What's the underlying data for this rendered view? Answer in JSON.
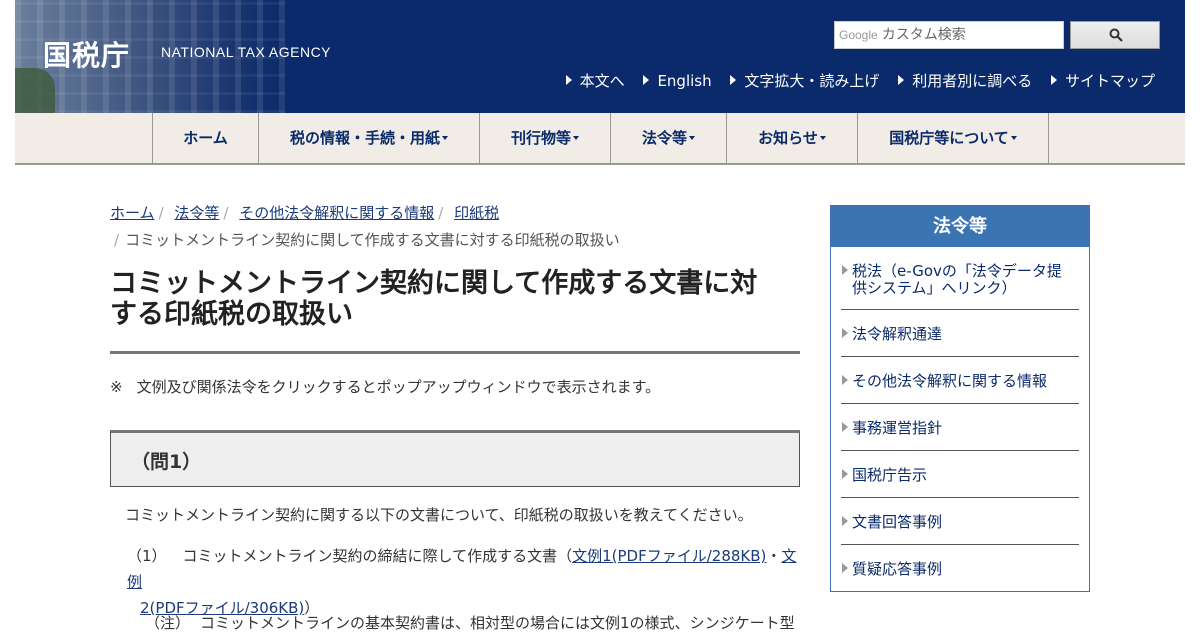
{
  "header": {
    "logo_jp": "国税庁",
    "logo_en": "NATIONAL TAX AGENCY",
    "search_brand": "Google",
    "search_placeholder": "カスタム検索",
    "util_links": [
      "本文へ",
      "English",
      "文字拡大・読み上げ",
      "利用者別に調べる",
      "サイトマップ"
    ]
  },
  "nav": {
    "items": [
      {
        "label": "ホーム",
        "dropdown": false
      },
      {
        "label": "税の情報・手続・用紙",
        "dropdown": true
      },
      {
        "label": "刊行物等",
        "dropdown": true
      },
      {
        "label": "法令等",
        "dropdown": true
      },
      {
        "label": "お知らせ",
        "dropdown": true
      },
      {
        "label": "国税庁等について",
        "dropdown": true
      }
    ]
  },
  "breadcrumb": {
    "links": [
      "ホーム",
      "法令等",
      "その他法令解釈に関する情報",
      "印紙税"
    ],
    "current": "コミットメントライン契約に関して作成する文書に対する印紙税の取扱い"
  },
  "main": {
    "title_line1": "コミットメントライン契約に関して作成する文書に対",
    "title_line2": "する印紙税の取扱い",
    "note_mark": "※",
    "note_text": "文例及び関係法令をクリックするとポップアップウィンドウで表示されます。",
    "question_heading": "（問1）",
    "question_text": "コミットメントライン契約に関する以下の文書について、印紙税の取扱いを教えてください。",
    "item1": {
      "num": "（1）",
      "text": "コミットメントライン契約の締結に際して作成する文書（",
      "link1": "文例1(PDFファイル/288KB)",
      "middle": "・",
      "link2_part1": "文例",
      "link2_part2": "2(PDFファイル/306KB)",
      "end": "）"
    },
    "note2": {
      "label": "（注）",
      "text": "コミットメントラインの基本契約書は、相対型の場合には文例1の様式、シンジケート型"
    }
  },
  "sidebar": {
    "title": "法令等",
    "items": [
      {
        "line1": "税法（e-Govの「法令データ提",
        "line2": "供システム」へリンク）"
      },
      {
        "line1": "法令解釈通達",
        "line2": ""
      },
      {
        "line1": "その他法令解釈に関する情報",
        "line2": ""
      },
      {
        "line1": "事務運営指針",
        "line2": ""
      },
      {
        "line1": "国税庁告示",
        "line2": ""
      },
      {
        "line1": "文書回答事例",
        "line2": ""
      },
      {
        "line1": "質疑応答事例",
        "line2": ""
      }
    ]
  },
  "colors": {
    "header_bg": "#0a2a6b",
    "nav_bg": "#f1ede6",
    "sidebar_head": "#3a74b3",
    "link": "#1a3a7a"
  }
}
